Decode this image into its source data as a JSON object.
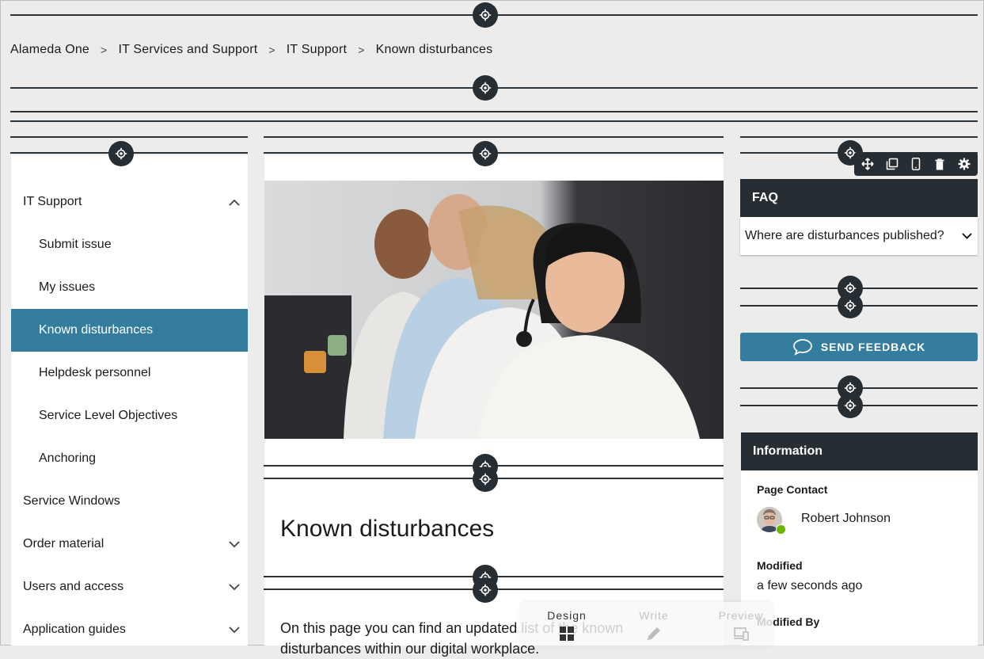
{
  "breadcrumb": [
    "Alameda One",
    "IT Services and Support",
    "IT Support",
    "Known disturbances"
  ],
  "breadcrumb_separator": ">",
  "nav": {
    "items": [
      {
        "label": "IT Support",
        "level": "top",
        "chevron": "chevron-up-icon"
      },
      {
        "label": "Submit issue",
        "level": "sub"
      },
      {
        "label": "My issues",
        "level": "sub"
      },
      {
        "label": "Known disturbances",
        "level": "sub",
        "active": true
      },
      {
        "label": "Helpdesk personnel",
        "level": "sub"
      },
      {
        "label": "Service Level Objectives",
        "level": "sub"
      },
      {
        "label": "Anchoring",
        "level": "sub"
      },
      {
        "label": "Service Windows",
        "level": "top"
      },
      {
        "label": "Order material",
        "level": "top",
        "chevron": "chevron-down-icon"
      },
      {
        "label": "Users and access",
        "level": "top",
        "chevron": "chevron-down-icon"
      },
      {
        "label": "Application guides",
        "level": "top",
        "chevron": "chevron-down-icon"
      }
    ]
  },
  "main": {
    "hero_image": "support-team-headsets-photo",
    "title": "Known disturbances",
    "intro": "On this page you can find an updated list of the known disturbances within our digital workplace."
  },
  "toolbar": {
    "icons": [
      "move-icon",
      "copy-icon",
      "mobile-icon",
      "delete-icon",
      "settings-icon"
    ]
  },
  "faq": {
    "title": "FAQ",
    "question": "Where are disturbances published?"
  },
  "feedback": {
    "label": "SEND FEEDBACK",
    "icon": "chat-bubble-icon"
  },
  "info": {
    "title": "Information",
    "page_contact_label": "Page Contact",
    "contact_name": "Robert Johnson",
    "modified_label": "Modified",
    "modified_value": "a few seconds ago",
    "modified_by_label": "Modified By"
  },
  "modes": [
    {
      "label": "Design",
      "icon": "grid-icon",
      "active": true
    },
    {
      "label": "Write",
      "icon": "pencil-icon"
    },
    {
      "label": "Preview",
      "icon": "devices-icon"
    }
  ],
  "colors": {
    "accent": "#357d9f",
    "dark": "#262e33",
    "canvas": "#ececec",
    "presence": "#6bb700"
  }
}
